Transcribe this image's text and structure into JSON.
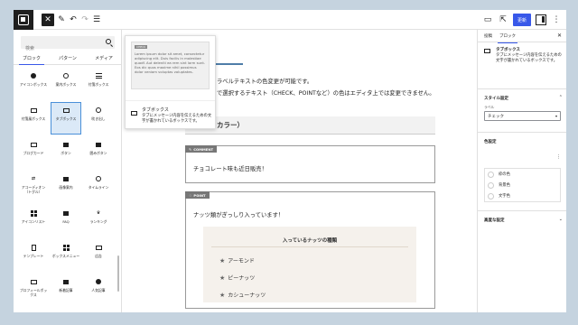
{
  "topbar": {
    "add_icon": "plus-icon",
    "pen_icon": "pen-icon",
    "undo_icon": "undo-icon",
    "redo_icon": "redo-icon",
    "list_icon": "list-view-icon",
    "save_label": "更新"
  },
  "inserter": {
    "search_placeholder": "検索",
    "tabs": [
      "ブロック",
      "パターン",
      "メディア"
    ],
    "blocks": [
      {
        "label": "アイコンボックス",
        "icon": "info-icon"
      },
      {
        "label": "案内ボックス",
        "icon": "circle-icon"
      },
      {
        "label": "付箋ボックス",
        "icon": "lines-icon"
      },
      {
        "label": "付箋風ボックス",
        "icon": "box-icon"
      },
      {
        "label": "タブボックス",
        "icon": "tab-box-icon"
      },
      {
        "label": "吹き出し",
        "icon": "speech-bubble-icon"
      },
      {
        "label": "ブログカード",
        "icon": "card-icon"
      },
      {
        "label": "ボタン",
        "icon": "button-icon"
      },
      {
        "label": "囲みボタン",
        "icon": "wrapped-button-icon"
      },
      {
        "label": "アコーディオン（トグル）",
        "icon": "toggle-icon"
      },
      {
        "label": "画像案内",
        "icon": "image-guide-icon"
      },
      {
        "label": "タイムライン",
        "icon": "timeline-icon"
      },
      {
        "label": "アイコンリスト",
        "icon": "icon-list-icon"
      },
      {
        "label": "FAQ",
        "icon": "faq-icon"
      },
      {
        "label": "ランキング",
        "icon": "crown-icon"
      },
      {
        "label": "テンプレート",
        "icon": "template-icon"
      },
      {
        "label": "ボックスメニュー",
        "icon": "grid-icon"
      },
      {
        "label": "広告",
        "icon": "ad-icon"
      },
      {
        "label": "プロフィールボックス",
        "icon": "profile-icon"
      },
      {
        "label": "新着記事",
        "icon": "new-posts-icon"
      },
      {
        "label": "人気記事",
        "icon": "flame-icon"
      },
      {
        "label": "",
        "icon": "document-icon"
      }
    ]
  },
  "preview": {
    "card_head": "CHECK",
    "card_text": "Lorem ipsum dolor sit amet, consectetur adipiscing elit. Duis facilis in molestiae quodf. Aut deleniti ea rem sint lorm sunt. Eos dic quos maxime nihil possimus dolor veniam voluptas voluptates.",
    "title": "タブボックス",
    "description": "タブにメッセージ内容を伝えるための文字が書かれているボックスです。"
  },
  "canvas": {
    "para1": "ラベルテキストの色変更が可能です。",
    "para2": "で選択するテキスト（CHECK、POINTなど）の色はエディタ上では変更できません。",
    "heading": "カラー）",
    "box1_label": "COMMENT",
    "box1_text": "チョコレート味も近日販売！",
    "box2_label": "POINT",
    "box2_text": "ナッツ類がぎっしり入っています！",
    "nut_title": "入っているナッツの種類",
    "nuts": [
      "アーモンド",
      "ピーナッツ",
      "カシューナッツ"
    ]
  },
  "sidebar": {
    "tabs": [
      "投稿",
      "ブロック"
    ],
    "block_title": "タブボックス",
    "block_desc": "タブにメッセージ内容を伝えるための文字が書かれているボックスです。",
    "style_section": "スタイル設定",
    "style_label": "ラベル",
    "style_value": "チェック",
    "color_section": "色設定",
    "color_options": [
      "枠の色",
      "背景色",
      "文字色"
    ],
    "advanced_section": "高度な設定"
  },
  "colors": {
    "accent": "#3858e9",
    "selected_bg": "#dbe9f7",
    "canvas_bg": "#c5d3df",
    "label_bg": "#777777",
    "nut_box_bg": "#f5f1ec"
  }
}
